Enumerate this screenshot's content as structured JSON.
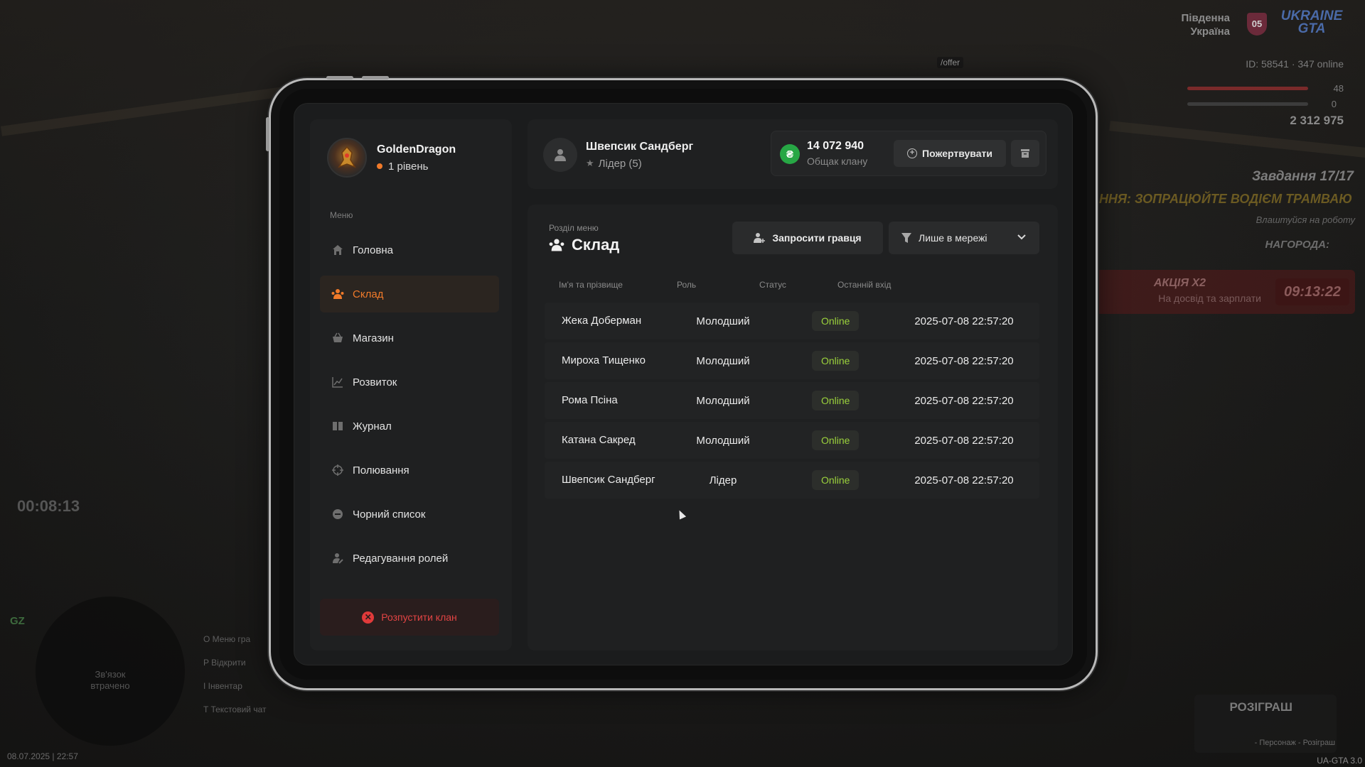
{
  "hud": {
    "region": [
      "Південна",
      "Україна"
    ],
    "region_badge": "05",
    "logo": "UKRAINE GTA",
    "offer": "/offer",
    "id_online": "ID: 58541 · 347 online",
    "hp": "48",
    "armor": "0",
    "money": "2 312 975",
    "tasks": "Завдання 17/17",
    "task_title": "ННЯ: ЗОПРАЦЮЙТЕ ВОДІЄМ ТРАМВАЮ",
    "task_sub": "Влаштуйся на роботу",
    "reward": "НАГОРОДА:",
    "promo_title": "АКЦІЯ Х2",
    "promo_sub": "На досвід та зарплати",
    "promo_timer": "09:13:22",
    "timer": "00:08:13",
    "gz": "GZ",
    "radar_text": "Зв'язок втрачено",
    "keys": [
      "O  Меню гра",
      "P  Відкрити",
      "I  Інвентар",
      "T  Текстовий чат"
    ],
    "datetime": "08.07.2025 | 22:57",
    "prize_title": "РОЗІГРАШ",
    "prize_sub": "- Персонаж - Розіграш",
    "version": "UA-GTA 3.0"
  },
  "profile": {
    "name": "GoldenDragon",
    "level": "1 рівень"
  },
  "menu": {
    "caption": "Меню",
    "items": [
      {
        "label": "Головна",
        "icon": "home-icon"
      },
      {
        "label": "Склад",
        "icon": "members-icon"
      },
      {
        "label": "Магазин",
        "icon": "basket-icon"
      },
      {
        "label": "Розвиток",
        "icon": "chart-icon"
      },
      {
        "label": "Журнал",
        "icon": "book-icon"
      },
      {
        "label": "Полювання",
        "icon": "crosshair-icon"
      },
      {
        "label": "Чорний список",
        "icon": "block-icon"
      },
      {
        "label": "Редагування ролей",
        "icon": "user-edit-icon"
      }
    ],
    "active": "Склад",
    "disband": "Розпустити клан"
  },
  "header": {
    "user_name": "Швепсик Сандберг",
    "user_role": "Лідер (5)",
    "treasury_amount": "14 072 940",
    "treasury_label": "Общак клану",
    "donate_label": "Пожертвувати",
    "coin_symbol": "₴"
  },
  "section": {
    "caption": "Розділ меню",
    "title": "Склад",
    "invite_label": "Запросити гравця",
    "filter_label": "Лише в мережі"
  },
  "table": {
    "columns": [
      "Ім'я та прізвище",
      "Роль",
      "Статус",
      "Останній вхід"
    ],
    "rows": [
      {
        "name": "Жека Доберман",
        "role": "Молодший",
        "status": "Online",
        "last": "2025-07-08 22:57:20"
      },
      {
        "name": "Мироха Тищенко",
        "role": "Молодший",
        "status": "Online",
        "last": "2025-07-08 22:57:20"
      },
      {
        "name": "Рома Псіна",
        "role": "Молодший",
        "status": "Online",
        "last": "2025-07-08 22:57:20"
      },
      {
        "name": "Катана Сакред",
        "role": "Молодший",
        "status": "Online",
        "last": "2025-07-08 22:57:20"
      },
      {
        "name": "Швепсик Сандберг",
        "role": "Лідер",
        "status": "Online",
        "last": "2025-07-08 22:57:20"
      }
    ]
  },
  "colors": {
    "accent": "#f07a2a",
    "online": "#9bd23c",
    "danger": "#e34444",
    "coin": "#27a745"
  }
}
